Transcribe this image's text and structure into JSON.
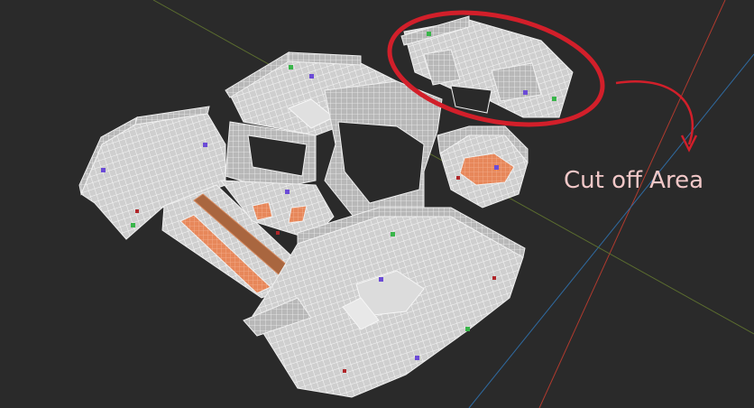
{
  "viewport": {
    "background": "#2a2a2a",
    "grid_colors": {
      "x_axis": "#b03a2e",
      "y_axis": "#2f6aa0",
      "z_axis": "#5b6d2f",
      "floor": "#cfcfcf",
      "wire": "#f5f5f5",
      "walls": "#bdbdbd"
    }
  },
  "annotation": {
    "text": "Cut off Area",
    "ring_color": "#d21f2a",
    "arrow_color": "#d21f2a",
    "label_color": "#f2c8c8"
  },
  "markers": {
    "green": "#39b54a",
    "purple": "#6b4bd6",
    "red": "#b0262a",
    "orange_pad": "#e7875a"
  }
}
